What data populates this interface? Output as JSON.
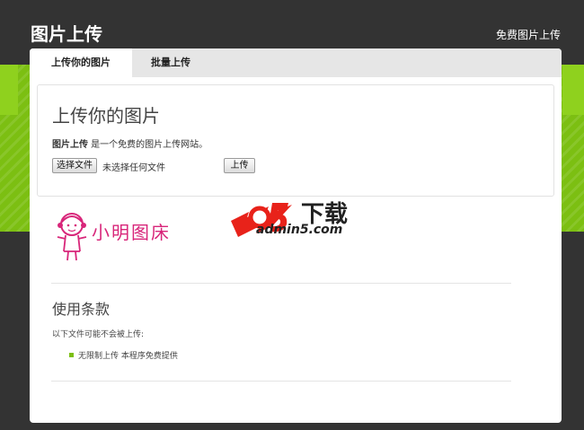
{
  "header": {
    "site_title": "图片上传",
    "top_link": "免费图片上传"
  },
  "tabs": [
    {
      "label": "上传你的图片",
      "active": true
    },
    {
      "label": "批量上传",
      "active": false
    }
  ],
  "upload_panel": {
    "title": "上传你的图片",
    "desc_strong": "图片上传",
    "desc_rest": " 是一个免费的图片上传网站。",
    "file_button": "选择文件",
    "file_status": "未选择任何文件",
    "upload_button": "上传"
  },
  "logos": {
    "xm_text": "小明图床",
    "a5_cn": "下载",
    "a5_url": "admin5.com"
  },
  "terms": {
    "title": "使用条款",
    "intro": "以下文件可能不会被上传:",
    "items": [
      "无限制上传 本程序免费提供"
    ]
  },
  "colors": {
    "header_bg": "#333333",
    "accent_green": "#7cbf12",
    "logo_pink": "#d8267a",
    "logo_red": "#e8221a"
  }
}
